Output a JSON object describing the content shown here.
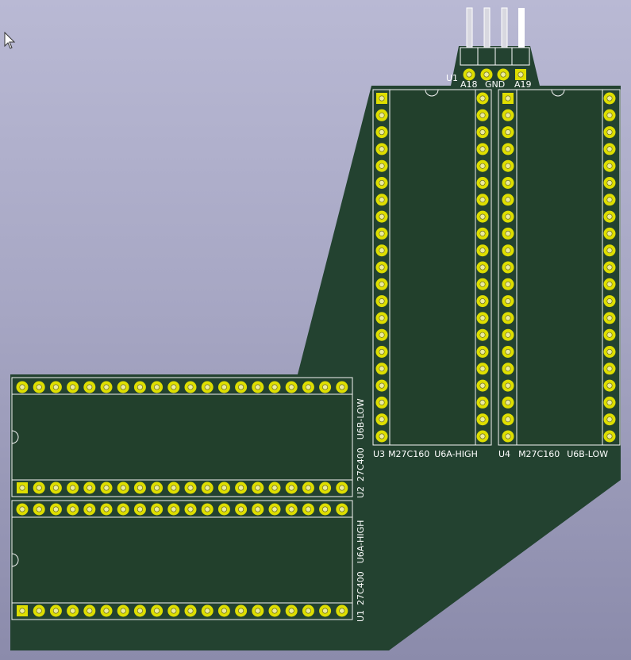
{
  "board": {
    "colors": {
      "board": "#234230",
      "silkscreen": "#f4f4f4",
      "pad": "#dede00",
      "background_top": "#b9b9d4",
      "background_bottom": "#8b8bab"
    }
  },
  "connector": {
    "ref": "U1",
    "pins": [
      "A18",
      "GND",
      "A19"
    ]
  },
  "chips": {
    "u3": {
      "ref": "U3",
      "part": "M27C160",
      "value": "U6A-HIGH"
    },
    "u4": {
      "ref": "U4",
      "part": "M27C160",
      "value": "U6B-LOW"
    },
    "u2": {
      "ref": "U2",
      "part": "27C400",
      "value": "U6B-LOW"
    },
    "u1": {
      "ref": "U1",
      "part": "27C400",
      "value": "U6A-HIGH"
    }
  },
  "cursor": {
    "icon": "mouse-pointer-icon"
  }
}
